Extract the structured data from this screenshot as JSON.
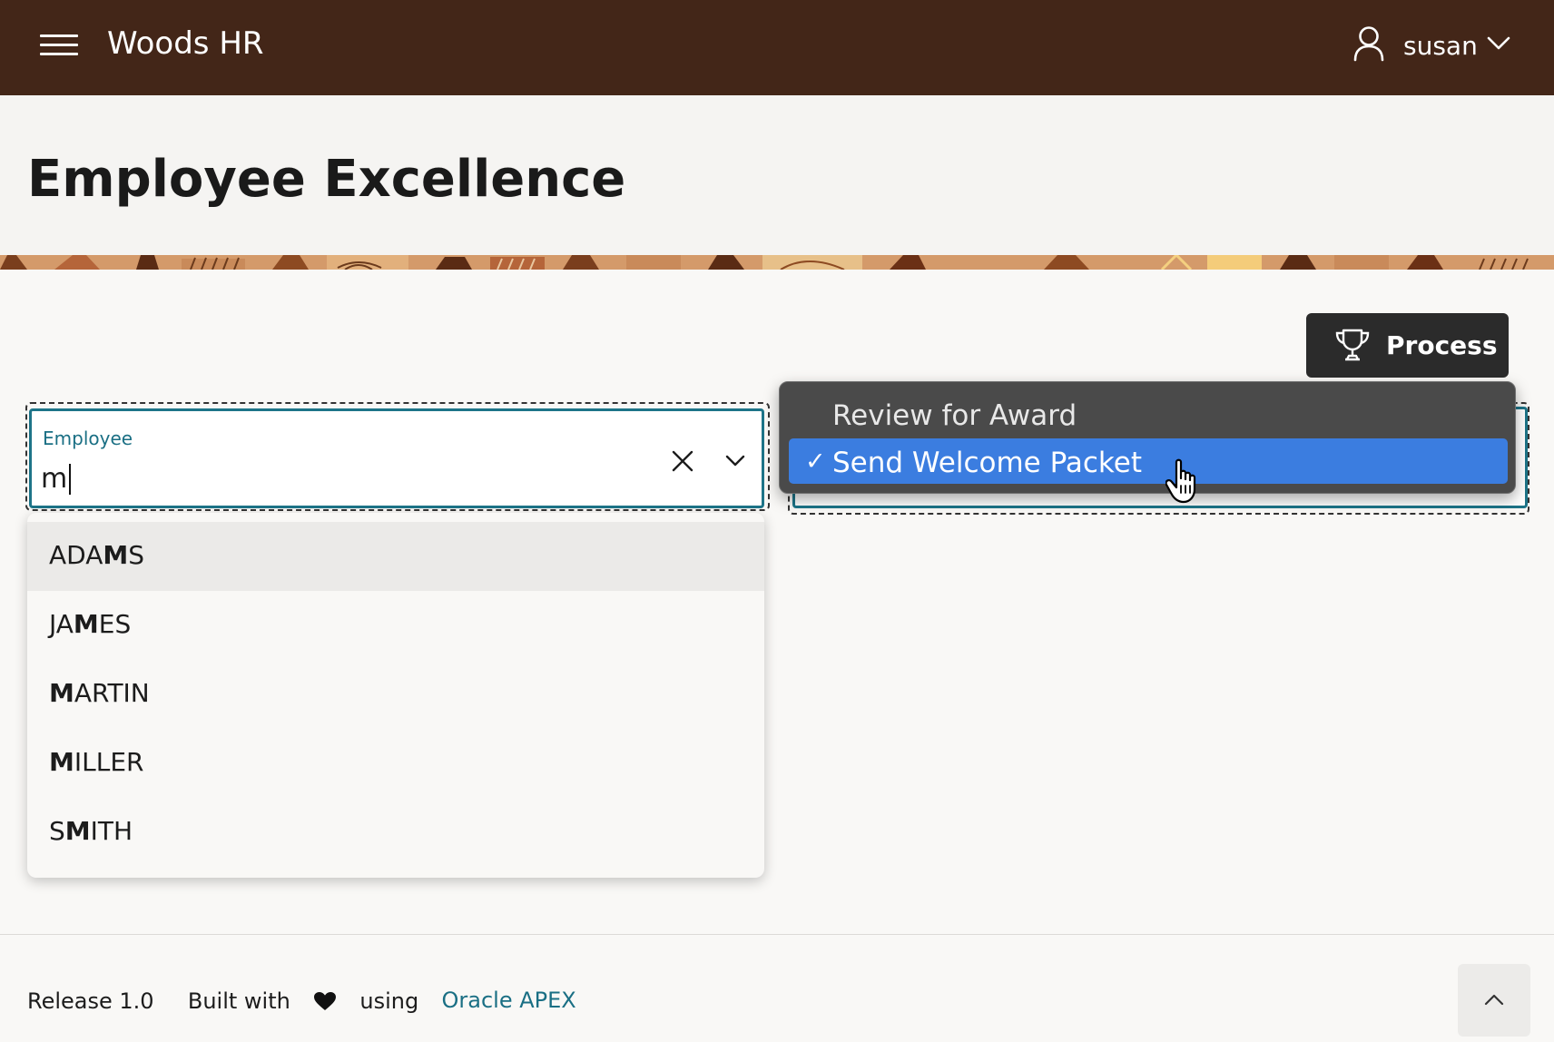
{
  "header": {
    "app_title": "Woods HR",
    "user_name": "susan",
    "menu_icon": "hamburger-menu-icon",
    "user_icon": "user-icon",
    "dropdown_icon": "chevron-down-icon",
    "background_color": "#432618"
  },
  "page": {
    "title": "Employee Excellence"
  },
  "process_button": {
    "label": "Process",
    "icon": "trophy-icon"
  },
  "employee_field": {
    "label": "Employee",
    "value": "m",
    "clear_icon": "close-icon",
    "open_icon": "chevron-down-icon",
    "accent_color": "#1d7488",
    "options": [
      {
        "pre": "ADA",
        "match": "M",
        "post": "S",
        "highlighted": true
      },
      {
        "pre": "JA",
        "match": "M",
        "post": "ES",
        "highlighted": false
      },
      {
        "pre": "",
        "match": "M",
        "post": "ARTIN",
        "highlighted": false
      },
      {
        "pre": "",
        "match": "M",
        "post": "ILLER",
        "highlighted": false
      },
      {
        "pre": "S",
        "match": "M",
        "post": "ITH",
        "highlighted": false
      }
    ]
  },
  "action_select": {
    "options": [
      {
        "label": "Review for Award",
        "selected": false
      },
      {
        "label": "Send Welcome Packet",
        "selected": true
      }
    ],
    "check_mark": "✓",
    "selected_color": "#3b7de0"
  },
  "footer": {
    "release": "Release 1.0",
    "built_with": "Built with",
    "using": "using",
    "link_text": "Oracle APEX",
    "heart_icon": "heart-icon",
    "scroll_top_icon": "chevron-up-icon"
  }
}
